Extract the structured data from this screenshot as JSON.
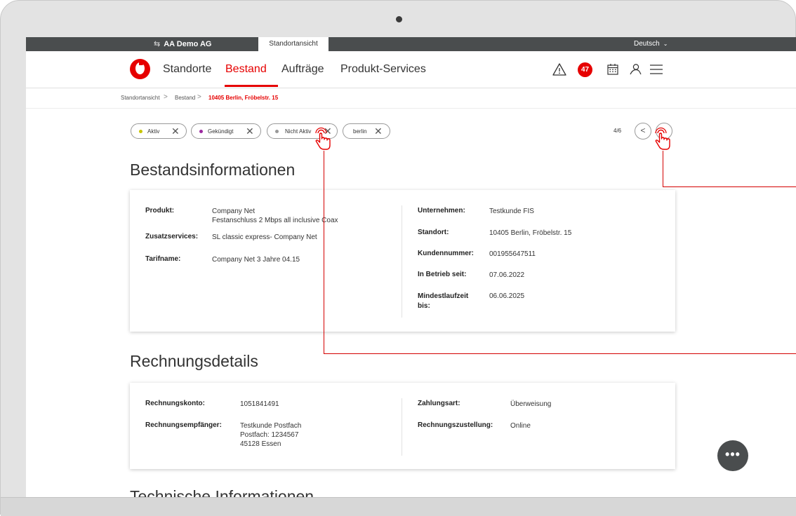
{
  "topbar": {
    "company": "AA Demo AG",
    "active_tab": "Standortansicht",
    "language": "Deutsch"
  },
  "nav": {
    "items": [
      "Standorte",
      "Bestand",
      "Aufträge",
      "Produkt-Services"
    ],
    "active": "Bestand",
    "notification_count": "47",
    "icons": [
      "warning-icon",
      "calendar-icon",
      "user-icon",
      "menu-icon"
    ]
  },
  "breadcrumb": [
    "Standortansicht",
    "Bestand",
    "10405 Berlin, Fröbelstr. 15"
  ],
  "filters": [
    {
      "label": "Aktiv",
      "color": "#c7c400"
    },
    {
      "label": "Gekündigt",
      "color": "#9c2aa0"
    },
    {
      "label": "Nicht Aktiv",
      "color": "#999999"
    },
    {
      "label": "berlin"
    }
  ],
  "pager": {
    "text": "4/6"
  },
  "bestand": {
    "title": "Bestandsinformationen",
    "left": {
      "produkt_label": "Produkt:",
      "produkt_value_1": "Company Net",
      "produkt_value_2": "Festanschluss 2 Mbps all inclusive Coax",
      "zusatz_label": "Zusatzservices:",
      "zusatz_value": "SL classic express- Company Net",
      "tarif_label": "Tarifname:",
      "tarif_value": "Company Net 3 Jahre 04.15"
    },
    "right": {
      "unternehmen_label": "Unternehmen:",
      "unternehmen_value": "Testkunde FIS",
      "standort_label": "Standort:",
      "standort_value": "10405 Berlin, Fröbelstr. 15",
      "kundennr_label": "Kundennummer:",
      "kundennr_value": "001955647511",
      "betrieb_label": "In Betrieb seit:",
      "betrieb_value": "07.06.2022",
      "mindest_label_1": "Mindestlaufzeit",
      "mindest_label_2": "bis:",
      "mindest_value": "06.06.2025"
    }
  },
  "rechnung": {
    "title": "Rechnungsdetails",
    "konto_label": "Rechnungskonto:",
    "konto_value": "1051841491",
    "empf_label": "Rechnungsempfänger:",
    "empf_value_1": "Testkunde Postfach",
    "empf_value_2": "Postfach: 1234567",
    "empf_value_3": "45128 Essen",
    "zahlung_label": "Zahlungsart:",
    "zahlung_value": "Überweisung",
    "zustellung_label": "Rechnungszustellung:",
    "zustellung_value": "Online"
  },
  "technik": {
    "title": "Technische Informationen"
  },
  "colors": {
    "brand_red": "#e60000",
    "topbar": "#4a4d4e"
  }
}
